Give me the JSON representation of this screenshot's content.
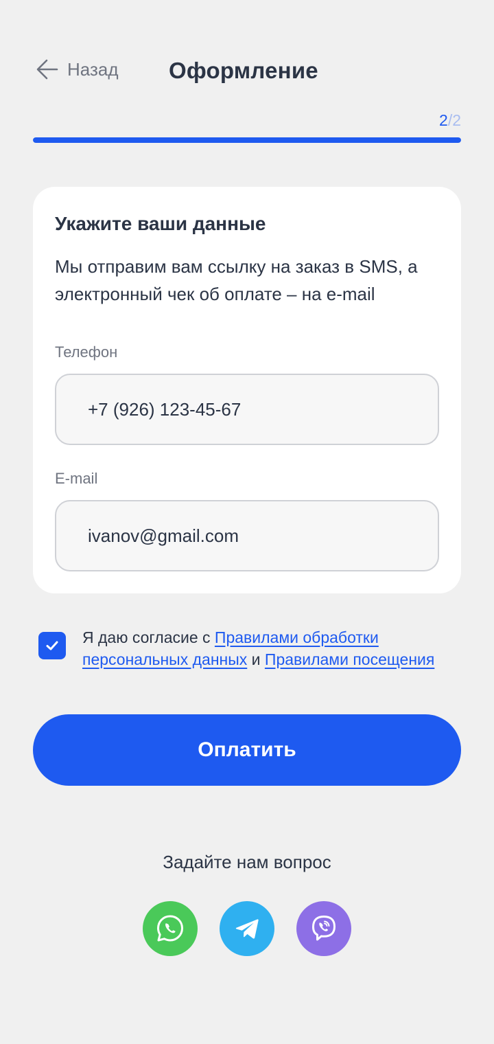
{
  "header": {
    "back_label": "Назад",
    "title": "Оформление"
  },
  "progress": {
    "current": "2",
    "separator": "/",
    "total": "2",
    "fraction": 1.0
  },
  "card": {
    "title": "Укажите ваши данные",
    "description": "Мы отправим вам ссылку на заказ в SMS, а электронный чек об оплате – на e-mail",
    "phone": {
      "label": "Телефон",
      "value": "+7 (926) 123-45-67"
    },
    "email": {
      "label": "E-mail",
      "value": "ivanov@gmail.com"
    }
  },
  "consent": {
    "checked": true,
    "prefix": "Я даю согласие с ",
    "link1": "Правилами обработки персональных данных",
    "middle": " и ",
    "link2": "Правилами посещения"
  },
  "pay_button": {
    "label": "Оплатить"
  },
  "ask": {
    "text": "Задайте нам вопрос"
  },
  "socials": [
    {
      "icon": "whatsapp-icon",
      "color": "#4ac959"
    },
    {
      "icon": "telegram-icon",
      "color": "#2fb0f0"
    },
    {
      "icon": "viber-icon",
      "color": "#8d6fe6"
    }
  ],
  "colors": {
    "accent": "#1e5af0",
    "background": "#f0f0f0",
    "card": "#ffffff",
    "text": "#2b3445",
    "muted": "#6f7480"
  }
}
